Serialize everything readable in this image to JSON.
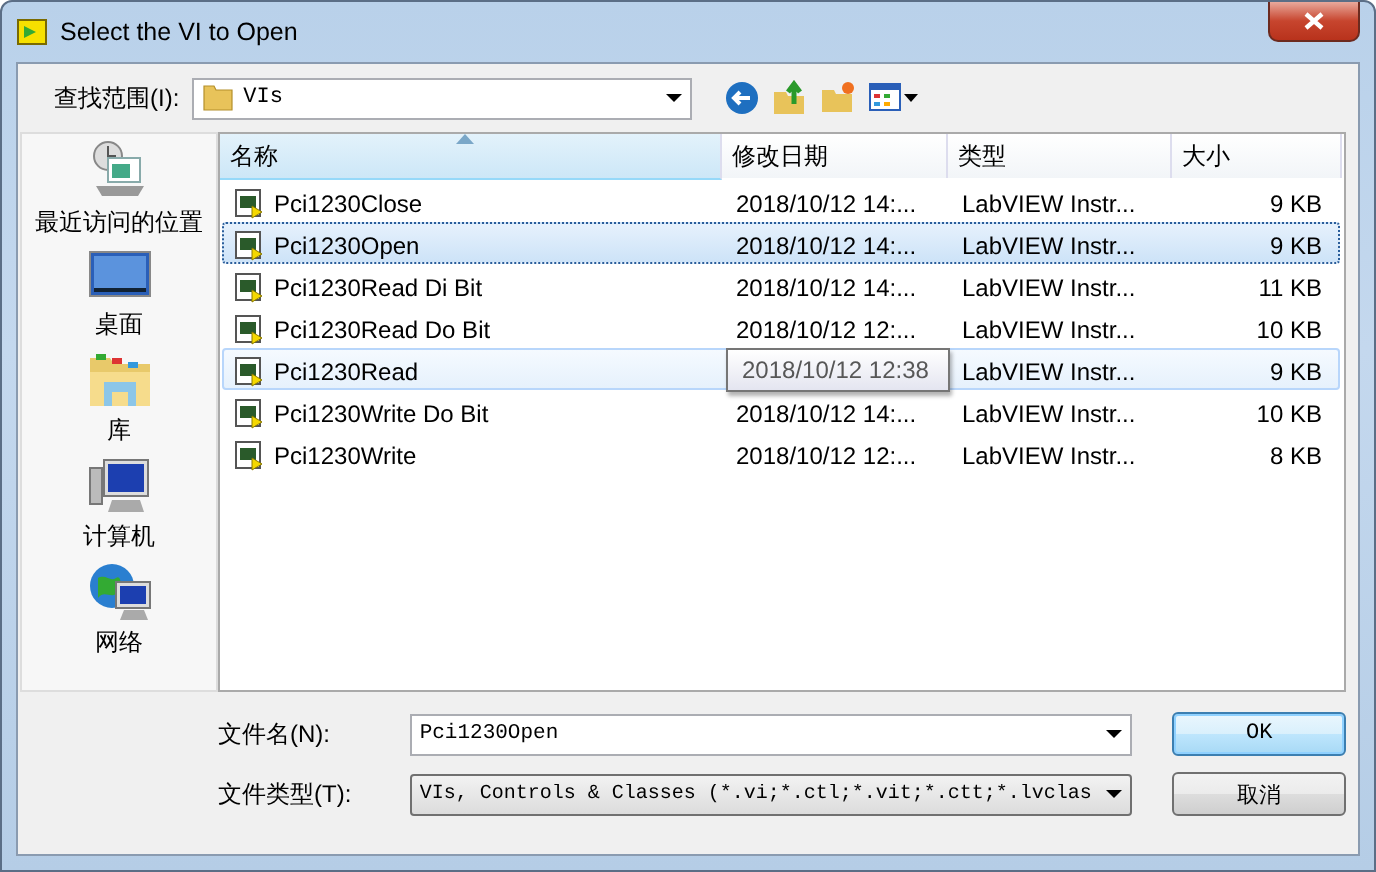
{
  "window": {
    "title": "Select the VI to Open"
  },
  "look_in": {
    "label": "查找范围(I):",
    "value": "VIs"
  },
  "places": [
    {
      "label": "最近访问的位置",
      "kind": "recent"
    },
    {
      "label": "桌面",
      "kind": "desktop"
    },
    {
      "label": "库",
      "kind": "library"
    },
    {
      "label": "计算机",
      "kind": "computer"
    },
    {
      "label": "网络",
      "kind": "network"
    }
  ],
  "table": {
    "columns": [
      "名称",
      "修改日期",
      "类型",
      "大小"
    ],
    "rows": [
      {
        "name": "Pci1230Close",
        "date": "2018/10/12 14:...",
        "type": "LabVIEW Instr...",
        "size": "9 KB",
        "selected": false,
        "hover": false
      },
      {
        "name": "Pci1230Open",
        "date": "2018/10/12 14:...",
        "type": "LabVIEW Instr...",
        "size": "9 KB",
        "selected": true,
        "hover": false
      },
      {
        "name": "Pci1230Read Di Bit",
        "date": "2018/10/12 14:...",
        "type": "LabVIEW Instr...",
        "size": "11 KB",
        "selected": false,
        "hover": false
      },
      {
        "name": "Pci1230Read Do Bit",
        "date": "2018/10/12 12:...",
        "type": "LabVIEW Instr...",
        "size": "10 KB",
        "selected": false,
        "hover": false
      },
      {
        "name": "Pci1230Read",
        "tooltip": "2018/10/12 12:38",
        "type": "LabVIEW Instr...",
        "size": "9 KB",
        "selected": false,
        "hover": true
      },
      {
        "name": "Pci1230Write Do Bit",
        "date": "2018/10/12 14:...",
        "type": "LabVIEW Instr...",
        "size": "10 KB",
        "selected": false,
        "hover": false
      },
      {
        "name": "Pci1230Write",
        "date": "2018/10/12 12:...",
        "type": "LabVIEW Instr...",
        "size": "8 KB",
        "selected": false,
        "hover": false
      }
    ]
  },
  "file_name": {
    "label": "文件名(N):",
    "value": "Pci1230Open"
  },
  "file_type": {
    "label": "文件类型(T):",
    "value": "VIs, Controls & Classes (*.vi;*.ctl;*.vit;*.ctt;*.lvclas"
  },
  "buttons": [
    "OK",
    "取消"
  ]
}
